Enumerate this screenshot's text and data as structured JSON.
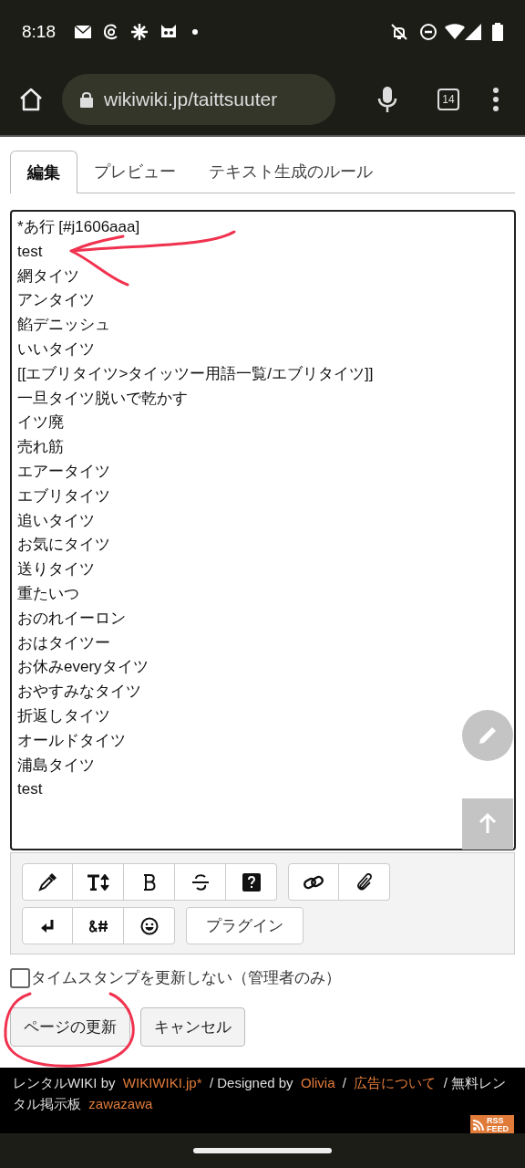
{
  "status_bar": {
    "time": "8:18"
  },
  "browser": {
    "url": "wikiwiki.jp/taittsuuter",
    "tab_count": "14"
  },
  "tabs": [
    {
      "label": "編集",
      "selected": true
    },
    {
      "label": "プレビュー",
      "selected": false
    },
    {
      "label": "テキスト生成のルール",
      "selected": false
    }
  ],
  "editor": {
    "lines": [
      "*あ行 [#j1606aaa]",
      "test",
      "網タイツ",
      "アンタイツ",
      "餡デニッシュ",
      "いいタイツ",
      "[[エブリタイツ>タイッツー用語一覧/エブリタイツ]]",
      "一旦タイツ脱いで乾かす",
      "イツ廃",
      "売れ筋",
      "エアータイツ",
      "エブリタイツ",
      "追いタイツ",
      "お気にタイツ",
      "送りタイツ",
      "重たいつ",
      "おのれイーロン",
      "おはタイツー",
      "お休みeveryタイツ",
      "おやすみなタイツ",
      "折返しタイツ",
      "オールドタイツ",
      "浦島タイツ",
      "test"
    ]
  },
  "toolbar": {
    "plugin_button": "プラグイン"
  },
  "timestamp_option": {
    "label": "タイムスタンプを更新しない（管理者のみ）",
    "checked": false
  },
  "buttons": [
    "ページの更新",
    "キャンセル"
  ],
  "footer": {
    "parts": [
      {
        "kind": "text",
        "text": "レンタルWIKI by"
      },
      {
        "kind": "link",
        "text": "WIKIWIKI.jp*"
      },
      {
        "kind": "text",
        "text": "/ Designed by"
      },
      {
        "kind": "link",
        "text": "Olivia"
      },
      {
        "kind": "text",
        "text": "/"
      },
      {
        "kind": "link",
        "text": "広告について"
      },
      {
        "kind": "text",
        "text": "/ 無料レンタル掲示板"
      },
      {
        "kind": "link",
        "text": "zawazawa"
      }
    ],
    "rss": [
      "RSS",
      "FEED"
    ]
  }
}
